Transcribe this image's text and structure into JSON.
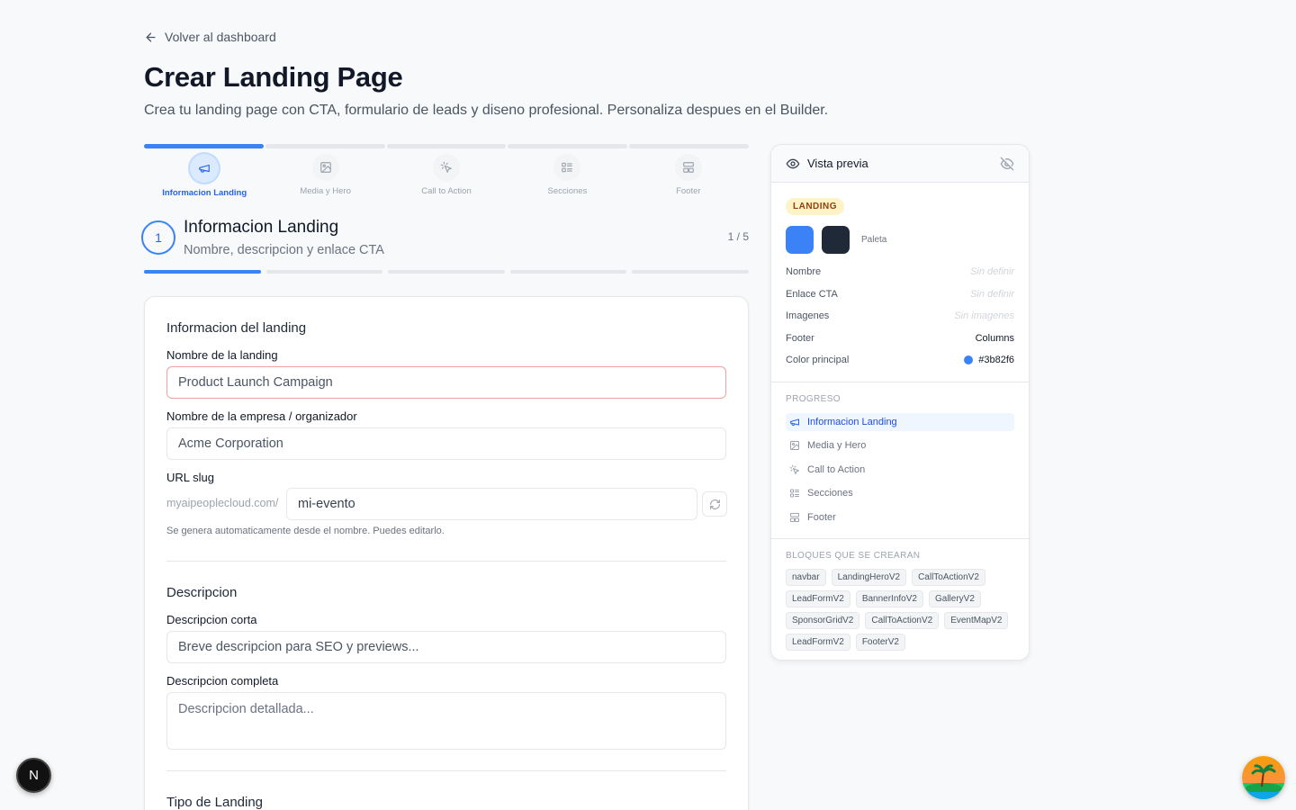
{
  "nav": {
    "back_label": "Volver al dashboard"
  },
  "header": {
    "title": "Crear Landing Page",
    "subtitle": "Crea tu landing page con CTA, formulario de leads y diseno profesional. Personaliza despues en el Builder."
  },
  "stepper": {
    "steps": [
      {
        "label": "Informacion Landing",
        "icon": "megaphone-icon"
      },
      {
        "label": "Media y Hero",
        "icon": "image-icon"
      },
      {
        "label": "Call to Action",
        "icon": "cursor-click-icon"
      },
      {
        "label": "Secciones",
        "icon": "list-icon"
      },
      {
        "label": "Footer",
        "icon": "layout-icon"
      }
    ],
    "current": 1
  },
  "current_step": {
    "number": "1",
    "title": "Informacion Landing",
    "description": "Nombre, descripcion y enlace CTA",
    "count": "1 / 5"
  },
  "form": {
    "section_info": "Informacion del landing",
    "name_label": "Nombre de la landing",
    "name_placeholder": "Product Launch Campaign",
    "company_label": "Nombre de la empresa / organizador",
    "company_placeholder": "Acme Corporation",
    "slug_label": "URL slug",
    "slug_prefix": "myaipeoplecloud.com/",
    "slug_value": "mi-evento",
    "slug_hint": "Se genera automaticamente desde el nombre. Puedes editarlo.",
    "section_desc": "Descripcion",
    "short_desc_label": "Descripcion corta",
    "short_desc_placeholder": "Breve descripcion para SEO y previews...",
    "full_desc_label": "Descripcion completa",
    "full_desc_placeholder": "Descripcion detallada...",
    "section_type": "Tipo de Landing"
  },
  "preview": {
    "title": "Vista previa",
    "badge": "LANDING",
    "palette_label": "Paleta",
    "colors": {
      "primary": "#3b82f6",
      "secondary": "#1f2937"
    },
    "rows": [
      {
        "key": "Nombre",
        "value": "Sin definir"
      },
      {
        "key": "Enlace CTA",
        "value": "Sin definir"
      },
      {
        "key": "Imagenes",
        "value": "Sin imagenes"
      },
      {
        "key": "Footer",
        "value": "Columns"
      },
      {
        "key": "Color principal",
        "value": "#3b82f6"
      }
    ],
    "progress_label": "PROGRESO",
    "progress_items": [
      "Informacion Landing",
      "Media y Hero",
      "Call to Action",
      "Secciones",
      "Footer"
    ],
    "blocks_label": "BLOQUES QUE SE CREARAN",
    "blocks": [
      "navbar",
      "LandingHeroV2",
      "CallToActionV2",
      "LeadFormV2",
      "BannerInfoV2",
      "GalleryV2",
      "SponsorGridV2",
      "CallToActionV2",
      "EventMapV2",
      "LeadFormV2",
      "FooterV2"
    ]
  },
  "floating": {
    "dev_badge": "N"
  }
}
